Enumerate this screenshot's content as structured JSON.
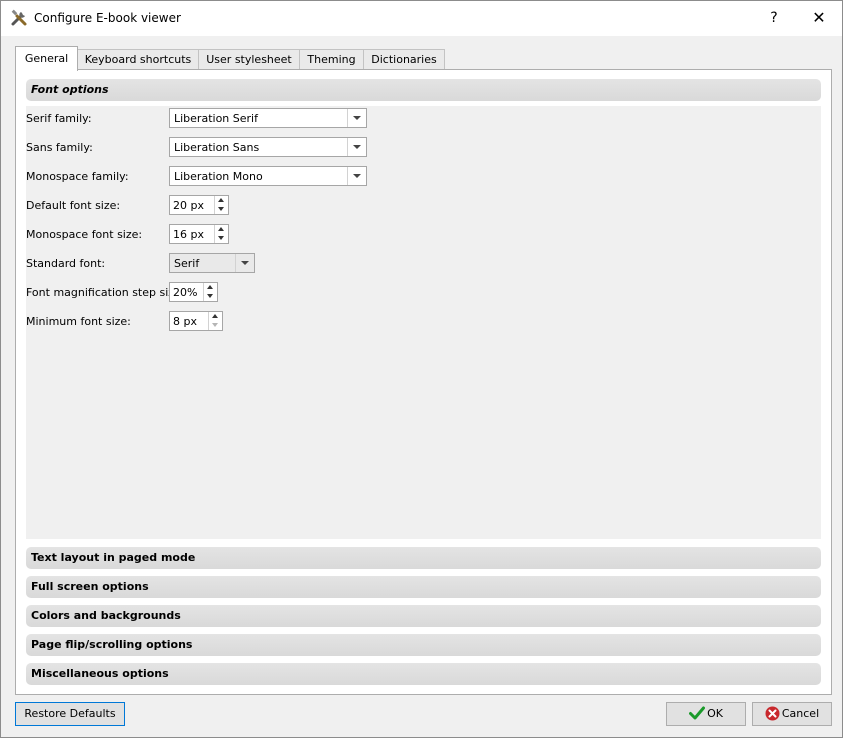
{
  "window": {
    "title": "Configure E-book viewer",
    "help": "?",
    "close": "✕"
  },
  "tabs": [
    {
      "label": "General",
      "active": true
    },
    {
      "label": "Keyboard shortcuts"
    },
    {
      "label": "User stylesheet"
    },
    {
      "label": "Theming"
    },
    {
      "label": "Dictionaries"
    }
  ],
  "sections": {
    "font_options": "Font options",
    "text_layout": "Text layout in paged mode",
    "full_screen": "Full screen options",
    "colors": "Colors and backgrounds",
    "page_flip": "Page flip/scrolling options",
    "misc": "Miscellaneous options"
  },
  "font": {
    "serif": {
      "label": "Serif family:",
      "value": "Liberation Serif"
    },
    "sans": {
      "label": "Sans family:",
      "value": "Liberation Sans"
    },
    "mono": {
      "label": "Monospace family:",
      "value": "Liberation Mono"
    },
    "default_size": {
      "label": "Default font size:",
      "value": "20 px"
    },
    "mono_size": {
      "label": "Monospace font size:",
      "value": "16 px"
    },
    "standard": {
      "label": "Standard font:",
      "value": "Serif"
    },
    "magnification": {
      "label": "Font magnification step size:",
      "value": "20%"
    },
    "minimum": {
      "label": "Minimum font size:",
      "value": "8 px"
    }
  },
  "buttons": {
    "restore": "Restore Defaults",
    "ok": "OK",
    "cancel": "Cancel"
  },
  "colors": {
    "ok_check": "#1a9a2a",
    "cancel_x": "#c8282d",
    "focus_border": "#0078d7"
  }
}
